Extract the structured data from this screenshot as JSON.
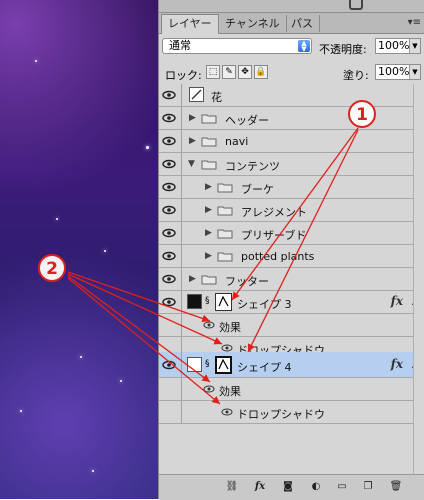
{
  "tabs": [
    "レイヤー",
    "チャンネル",
    "パス"
  ],
  "blend_mode": "通常",
  "opacity_label": "不透明度:",
  "opacity_value": "100%",
  "lock_label": "ロック:",
  "fill_label": "塗り:",
  "fill_value": "100%",
  "layers": {
    "hana": "花",
    "header": "ヘッダー",
    "navi": "navi",
    "contents": "コンテンツ",
    "bouquet": "ブーケ",
    "arrangement": "アレジメント",
    "preserved": "プリザーブド",
    "potted": "potted plants",
    "footer": "フッター",
    "shape3": "シェイプ 3",
    "effects3": "効果",
    "dropshadow3": "ドロップシャドウ",
    "shape4": "シェイプ 4",
    "effects4": "効果",
    "dropshadow4": "ドロップシャドウ"
  },
  "annotations": {
    "badge1": "1",
    "badge2": "2",
    "color": "#e0201a"
  },
  "colors": {
    "selected_row": "#b6cff0",
    "panel": "#d6d6d6"
  }
}
